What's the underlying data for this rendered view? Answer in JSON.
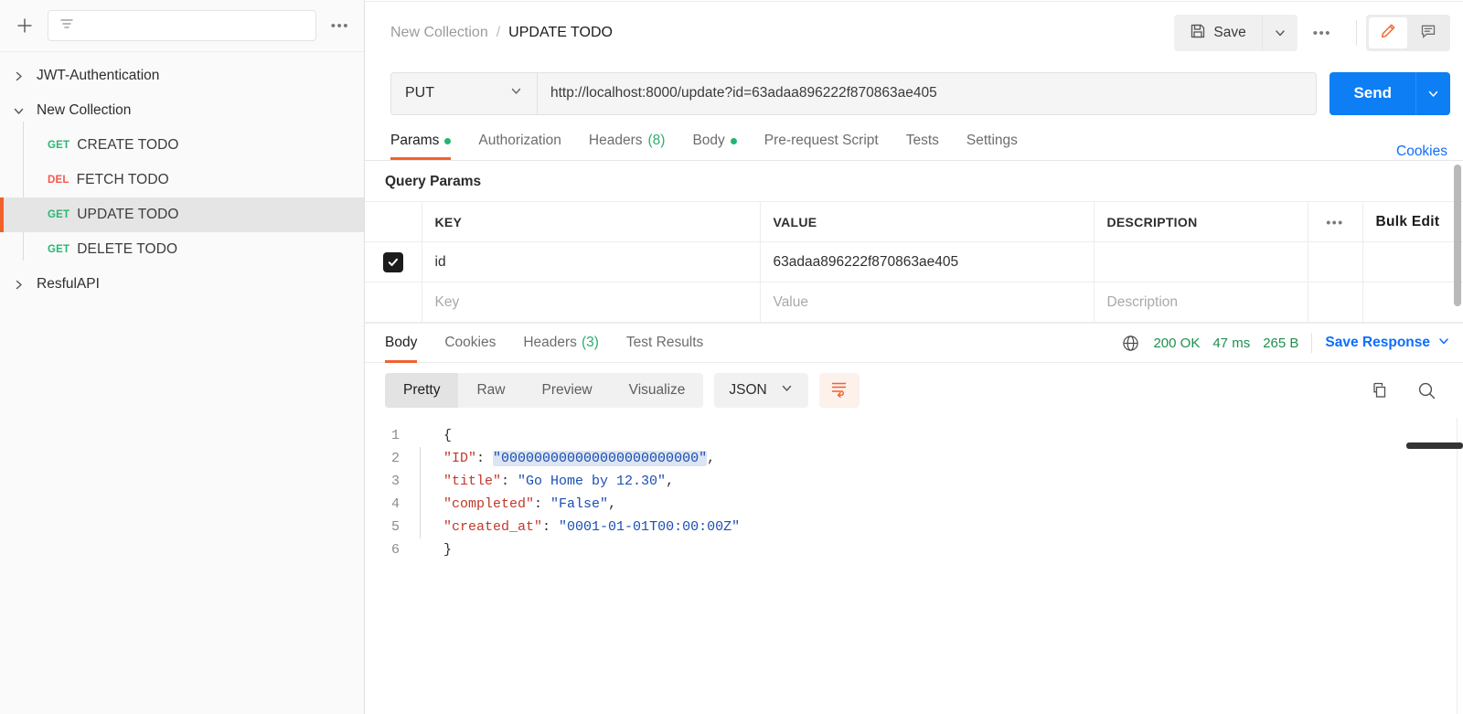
{
  "sidebar": {
    "toolbar": {
      "add_label": "+",
      "filter_placeholder": "",
      "more_label": "•••"
    },
    "tree": [
      {
        "type": "collection",
        "label": "JWT-Authentication",
        "expanded": false
      },
      {
        "type": "collection",
        "label": "New Collection",
        "expanded": true
      },
      {
        "type": "collection",
        "label": "ResfulAPI",
        "expanded": false
      }
    ],
    "requests": [
      {
        "method": "GET",
        "label": "CREATE TODO",
        "selected": false
      },
      {
        "method": "DEL",
        "label": "FETCH TODO",
        "selected": false
      },
      {
        "method": "GET",
        "label": "UPDATE TODO",
        "selected": true
      },
      {
        "method": "GET",
        "label": "DELETE TODO",
        "selected": false
      }
    ]
  },
  "header": {
    "breadcrumb_collection": "New Collection",
    "breadcrumb_separator": "/",
    "breadcrumb_current": "UPDATE TODO",
    "save_label": "Save",
    "more_label": "•••"
  },
  "request": {
    "method": "PUT",
    "url": "http://localhost:8000/update?id=63adaa896222f870863ae405",
    "send_label": "Send",
    "tabs": [
      {
        "label": "Params",
        "dot": true,
        "active": true
      },
      {
        "label": "Authorization",
        "dot": false,
        "active": false
      },
      {
        "label": "Headers",
        "count": "(8)",
        "active": false
      },
      {
        "label": "Body",
        "dot": true,
        "active": false
      },
      {
        "label": "Pre-request Script",
        "active": false
      },
      {
        "label": "Tests",
        "active": false
      },
      {
        "label": "Settings",
        "active": false
      }
    ],
    "cookies_link": "Cookies"
  },
  "query_params": {
    "title": "Query Params",
    "columns": [
      "KEY",
      "VALUE",
      "DESCRIPTION"
    ],
    "more_label": "•••",
    "bulk_edit_label": "Bulk Edit",
    "rows": [
      {
        "checked": true,
        "key": "id",
        "value": "63adaa896222f870863ae405",
        "description": ""
      }
    ],
    "placeholder_row": {
      "key": "Key",
      "value": "Value",
      "description": "Description"
    }
  },
  "response": {
    "tabs": [
      {
        "label": "Body",
        "active": true
      },
      {
        "label": "Cookies",
        "active": false
      },
      {
        "label": "Headers",
        "count": "(3)",
        "active": false
      },
      {
        "label": "Test Results",
        "active": false
      }
    ],
    "status": "200 OK",
    "time": "47 ms",
    "size": "265 B",
    "save_response_label": "Save Response",
    "format_tabs": [
      {
        "label": "Pretty",
        "active": true
      },
      {
        "label": "Raw",
        "active": false
      },
      {
        "label": "Preview",
        "active": false
      },
      {
        "label": "Visualize",
        "active": false
      }
    ],
    "language": "JSON",
    "body_lines": [
      {
        "n": "1",
        "text": "{"
      },
      {
        "n": "2",
        "text": "    \"ID\": \"000000000000000000000000\","
      },
      {
        "n": "3",
        "text": "    \"title\": \"Go Home by 12.30\","
      },
      {
        "n": "4",
        "text": "    \"completed\": \"False\","
      },
      {
        "n": "5",
        "text": "    \"created_at\": \"0001-01-01T00:00:00Z\""
      },
      {
        "n": "6",
        "text": "}"
      }
    ],
    "json": {
      "ID": "000000000000000000000000",
      "title": "Go Home by 12.30",
      "completed": "False",
      "created_at": "0001-01-01T00:00:00Z"
    }
  },
  "colors": {
    "accent_orange": "#f2612c",
    "send_blue": "#0d7ef4",
    "link_blue": "#0d6efd",
    "method_get_green": "#2bb673",
    "method_del_red": "#f4584f",
    "status_green": "#1f8f4d"
  }
}
